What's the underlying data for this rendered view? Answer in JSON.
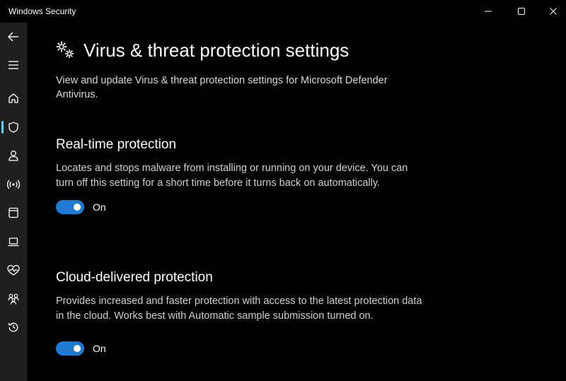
{
  "window": {
    "title": "Windows Security"
  },
  "colors": {
    "accent": "#60cdff",
    "toggle_on": "#1d7bd6",
    "sidebar_bg": "#1f1f1f",
    "background": "#000000"
  },
  "sidebar": {
    "items": [
      {
        "icon": "back-arrow-icon"
      },
      {
        "icon": "hamburger-menu-icon"
      },
      {
        "icon": "home-icon"
      },
      {
        "icon": "shield-icon",
        "active": true
      },
      {
        "icon": "person-icon"
      },
      {
        "icon": "wifi-antenna-icon"
      },
      {
        "icon": "app-browser-icon"
      },
      {
        "icon": "laptop-icon"
      },
      {
        "icon": "heart-pulse-icon"
      },
      {
        "icon": "family-icon"
      },
      {
        "icon": "history-icon"
      }
    ]
  },
  "page": {
    "title": "Virus & threat protection settings",
    "description": "View and update Virus & threat protection settings for Microsoft Defender Antivirus."
  },
  "sections": [
    {
      "title": "Real-time protection",
      "description": "Locates and stops malware from installing or running on your device. You can turn off this setting for a short time before it turns back on automatically.",
      "toggle_state": "On",
      "enabled": true
    },
    {
      "title": "Cloud-delivered protection",
      "description": "Provides increased and faster protection with access to the latest protection data in the cloud. Works best with Automatic sample submission turned on.",
      "toggle_state": "On",
      "enabled": true
    }
  ]
}
